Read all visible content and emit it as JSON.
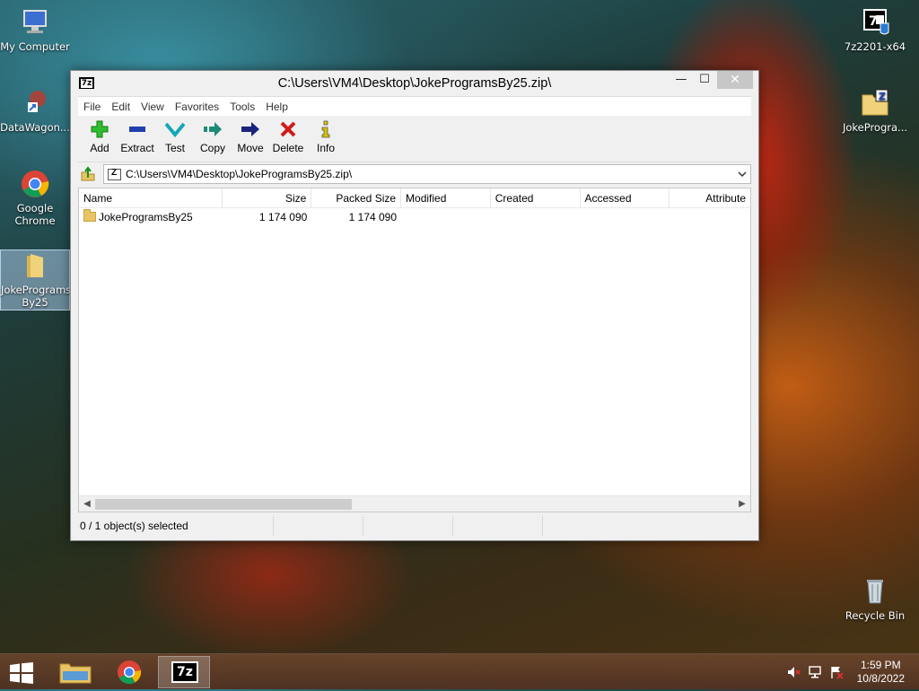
{
  "desktop": {
    "icons": [
      {
        "label": "My Computer",
        "icon": "computer-icon"
      },
      {
        "label": "DataWagon...",
        "icon": "shortcut-icon"
      },
      {
        "label": "Google Chrome",
        "icon": "chrome-icon"
      },
      {
        "label": "JokePrograms By25",
        "icon": "folder-icon"
      },
      {
        "label": "7z2201-x64",
        "icon": "7zip-installer-icon"
      },
      {
        "label": "JokeProgra...",
        "icon": "zip-archive-icon"
      },
      {
        "label": "Recycle Bin",
        "icon": "recycle-bin-icon"
      }
    ]
  },
  "window": {
    "title": "C:\\Users\\VM4\\Desktop\\JokeProgramsBy25.zip\\",
    "app_icon_text": "7z",
    "controls": {
      "minimize": "—",
      "maximize": "☐",
      "close": "✕"
    }
  },
  "menu": [
    "File",
    "Edit",
    "View",
    "Favorites",
    "Tools",
    "Help"
  ],
  "toolbar": [
    {
      "label": "Add",
      "icon": "add-icon",
      "color": "#22aa22"
    },
    {
      "label": "Extract",
      "icon": "extract-icon",
      "color": "#1f3fb0"
    },
    {
      "label": "Test",
      "icon": "test-icon",
      "color": "#18b8c8"
    },
    {
      "label": "Copy",
      "icon": "copy-icon",
      "color": "#1e8a78"
    },
    {
      "label": "Move",
      "icon": "move-icon",
      "color": "#1a237e"
    },
    {
      "label": "Delete",
      "icon": "delete-icon",
      "color": "#d11a1a"
    },
    {
      "label": "Info",
      "icon": "info-icon",
      "color": "#c9b800"
    }
  ],
  "address": {
    "path": "C:\\Users\\VM4\\Desktop\\JokeProgramsBy25.zip\\"
  },
  "columns": [
    "Name",
    "Size",
    "Packed Size",
    "Modified",
    "Created",
    "Accessed",
    "Attribute"
  ],
  "rows": [
    {
      "name": "JokeProgramsBy25",
      "size": "1 174 090",
      "packed": "1 174 090",
      "modified": "",
      "created": "",
      "accessed": "",
      "attributes": ""
    }
  ],
  "status": {
    "selection": "0 / 1 object(s) selected"
  },
  "taskbar": {
    "apps": [
      "file-explorer-icon",
      "chrome-icon",
      "7zip-icon"
    ],
    "active_app": "7zip-icon",
    "clock_time": "1:59 PM",
    "clock_date": "10/8/2022",
    "seven_zip_label": "7z"
  }
}
